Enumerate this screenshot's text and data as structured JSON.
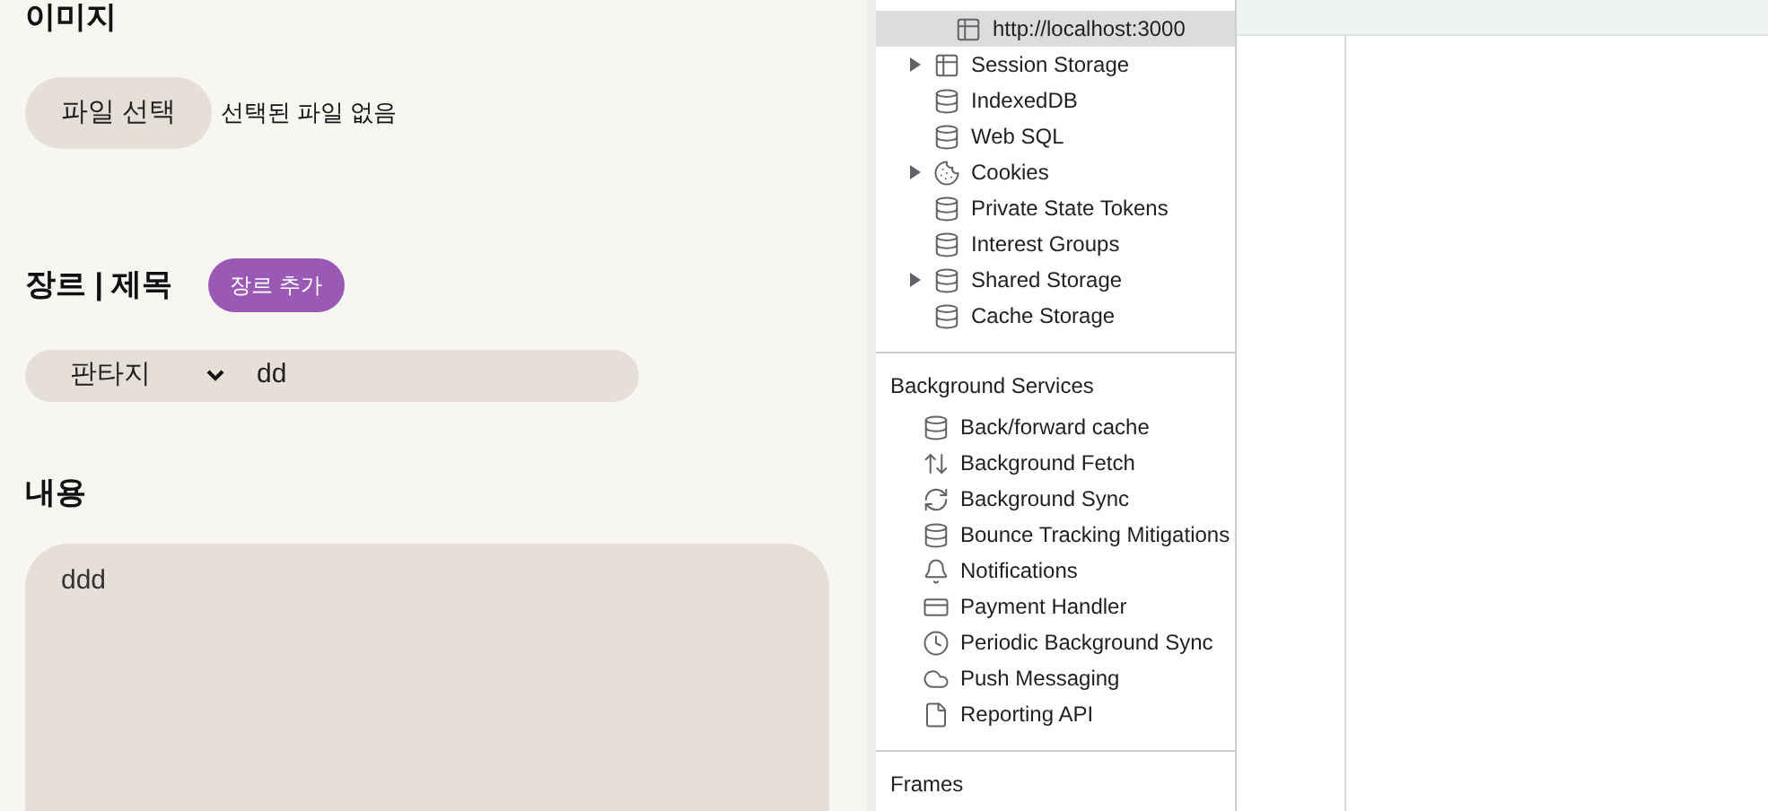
{
  "form": {
    "image_section": {
      "heading": "이미지",
      "file_button": "파일 선택",
      "file_status": "선택된 파일 없음"
    },
    "genre_section": {
      "heading": "장르 | 제목",
      "add_genre_button": "장르 추가",
      "genre_select": {
        "value": "판타지"
      },
      "title_field": {
        "value": "dd"
      }
    },
    "content_section": {
      "heading": "내용",
      "content_field": {
        "value": "ddd"
      }
    }
  },
  "devtools": {
    "local_storage_children": [
      {
        "kind": "table",
        "label": "http://localhost:3000",
        "selected": true
      }
    ],
    "storage_items": [
      {
        "kind": "table",
        "label": "Session Storage",
        "expandable": true,
        "selected": false
      },
      {
        "kind": "database",
        "label": "IndexedDB",
        "expandable": false,
        "selected": false
      },
      {
        "kind": "database",
        "label": "Web SQL",
        "expandable": false,
        "selected": false
      },
      {
        "kind": "cookie",
        "label": "Cookies",
        "expandable": true,
        "selected": false
      },
      {
        "kind": "database",
        "label": "Private State Tokens",
        "expandable": false,
        "selected": false
      },
      {
        "kind": "database",
        "label": "Interest Groups",
        "expandable": false,
        "selected": false
      },
      {
        "kind": "database",
        "label": "Shared Storage",
        "expandable": true,
        "selected": false
      },
      {
        "kind": "database",
        "label": "Cache Storage",
        "expandable": false,
        "selected": false
      }
    ],
    "sections": [
      {
        "title": "Background Services",
        "items": [
          {
            "kind": "database",
            "label": "Back/forward cache"
          },
          {
            "kind": "fetch",
            "label": "Background Fetch"
          },
          {
            "kind": "sync",
            "label": "Background Sync"
          },
          {
            "kind": "database",
            "label": "Bounce Tracking Mitigations"
          },
          {
            "kind": "bell",
            "label": "Notifications"
          },
          {
            "kind": "card",
            "label": "Payment Handler"
          },
          {
            "kind": "clock",
            "label": "Periodic Background Sync"
          },
          {
            "kind": "cloud",
            "label": "Push Messaging"
          },
          {
            "kind": "file",
            "label": "Reporting API"
          }
        ]
      },
      {
        "title": "Frames"
      }
    ]
  }
}
